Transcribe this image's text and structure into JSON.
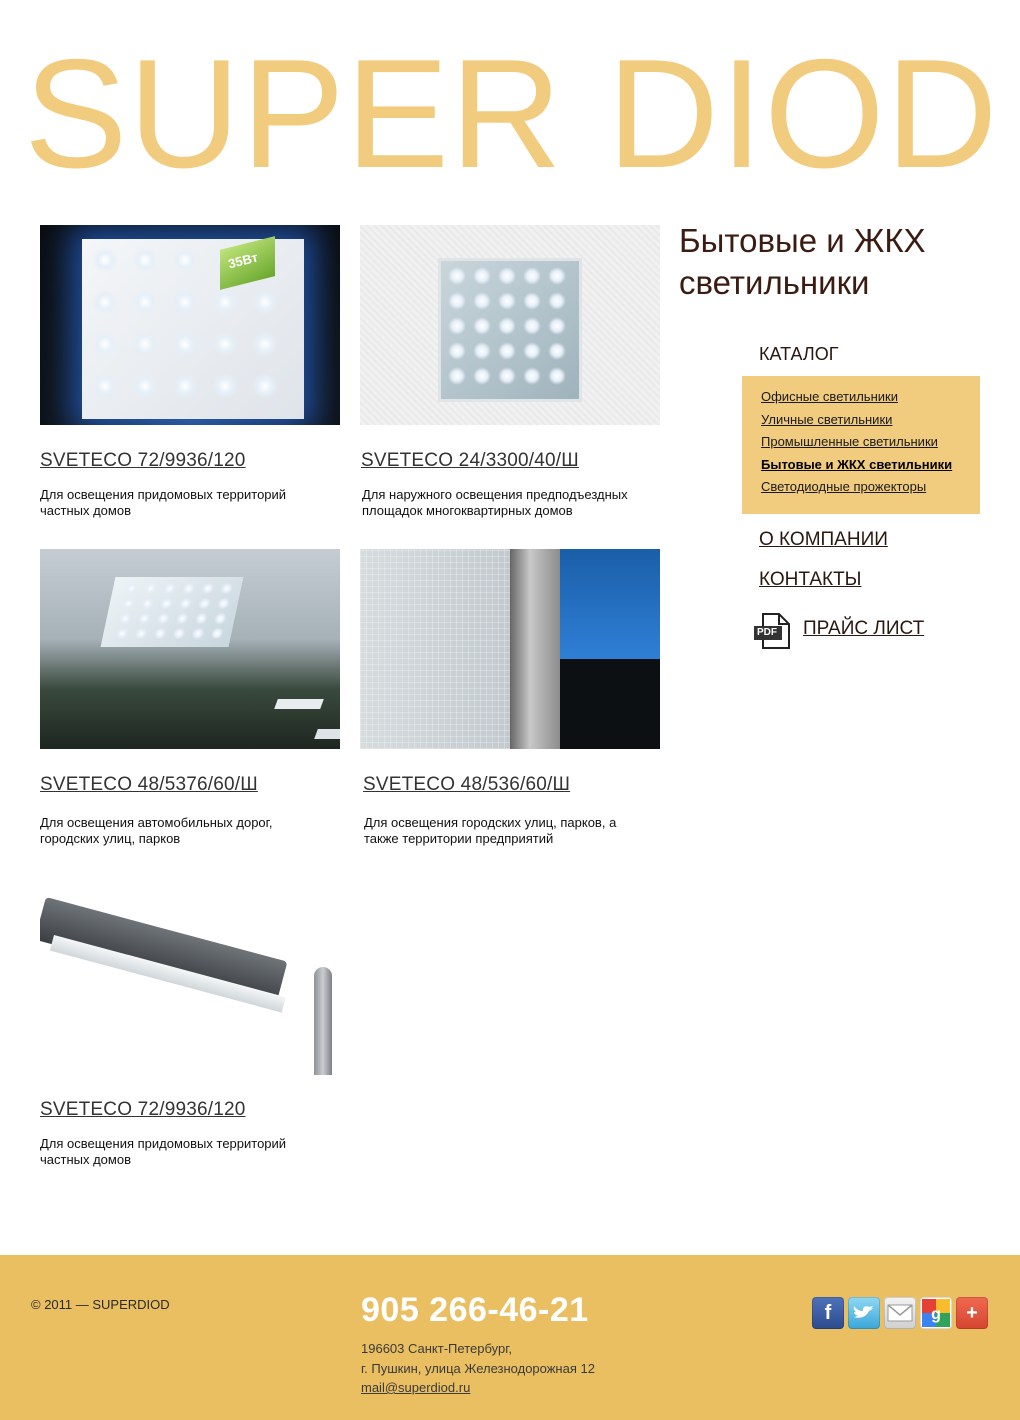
{
  "brand": {
    "logo_text": "SUPER DIOD"
  },
  "products": [
    {
      "title": "SVETECO 72/9936/120",
      "desc_line1": "Для освещения придомовых территорий",
      "desc_line2": "частных домов",
      "badge": "35Вт"
    },
    {
      "title": "SVETECO 24/3300/40/Ш",
      "desc_line1": "Для наружного освещения предподъездных",
      "desc_line2": "площадок многоквартирных домов"
    },
    {
      "title": "SVETECO 48/5376/60/Ш",
      "desc_line1": "Для освещения автомобильных дорог,",
      "desc_line2": "городских улиц, парков"
    },
    {
      "title": "SVETECO 48/536/60/Ш",
      "desc_line1": "Для освещения городских улиц, парков, а",
      "desc_line2": "также территории предприятий"
    },
    {
      "title": "SVETECO 72/9936/120",
      "desc_line1": "Для освещения придомовых территорий",
      "desc_line2": "частных домов"
    }
  ],
  "sidebar": {
    "heading_line1": "Бытовые и ЖКХ",
    "heading_line2": "светильники",
    "catalog_label": "КАТАЛОГ",
    "catalog_items": [
      "Офисные светильники",
      "Уличные светильники",
      "Промышленные светильники",
      "Бытовые и ЖКХ светильники",
      "Светодиодные прожекторы"
    ],
    "active_index": 3,
    "about_link": "О КОМПАНИИ",
    "contacts_link": "КОНТАКТЫ",
    "price_link": "ПРАЙС ЛИСТ",
    "pdf_label": "PDF"
  },
  "footer": {
    "copyright": "© 2011 — SUPERDIOD",
    "phone": "905 266-46-21",
    "address_line1": "196603 Санкт-Петербург,",
    "address_line2": "г. Пушкин, улица Железнодорожная 12",
    "email": "mail@superdiod.ru",
    "social": [
      "facebook-icon",
      "twitter-icon",
      "email-icon",
      "google-plus-icon",
      "share-plus-icon"
    ]
  },
  "colors": {
    "accent": "#f2cc7e",
    "footer_bg": "#eabf62",
    "heading": "#3a1c12"
  }
}
